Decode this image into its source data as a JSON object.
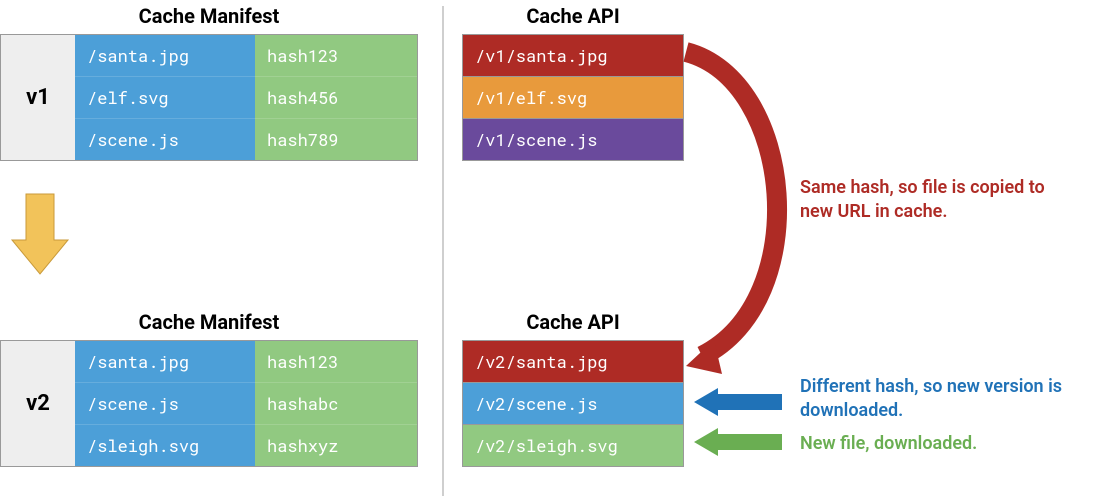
{
  "headings": {
    "manifest": "Cache Manifest",
    "api": "Cache API"
  },
  "manifest_v1": {
    "version": "v1",
    "rows": [
      {
        "file": "/santa.jpg",
        "hash": "hash123"
      },
      {
        "file": "/elf.svg",
        "hash": "hash456"
      },
      {
        "file": "/scene.js",
        "hash": "hash789"
      }
    ]
  },
  "manifest_v2": {
    "version": "v2",
    "rows": [
      {
        "file": "/santa.jpg",
        "hash": "hash123"
      },
      {
        "file": "/scene.js",
        "hash": "hashabc"
      },
      {
        "file": "/sleigh.svg",
        "hash": "hashxyz"
      }
    ]
  },
  "api_v1": {
    "rows": [
      {
        "prefix": "/v1",
        "file": "/santa.jpg",
        "color": "#ae2b25"
      },
      {
        "prefix": "/v1",
        "file": "/elf.svg",
        "color": "#e89a3c"
      },
      {
        "prefix": "/v1",
        "file": "/scene.js",
        "color": "#6a4a9c"
      }
    ]
  },
  "api_v2": {
    "rows": [
      {
        "prefix": "/v2",
        "file": "/santa.jpg",
        "color": "#ae2b25"
      },
      {
        "prefix": "/v2",
        "file": "/scene.js",
        "color": "#4c9fd8"
      },
      {
        "prefix": "/v2",
        "file": "/sleigh.svg",
        "color": "#91c981"
      }
    ]
  },
  "notes": {
    "same_hash": "Same hash, so file is copied to new URL in cache.",
    "diff_hash": "Different hash, so new version is downloaded.",
    "new_file": "New file, downloaded."
  },
  "colors": {
    "down_arrow": "#f2c35a",
    "curve_arrow": "#ae2b25",
    "diff_arrow": "#2072b7",
    "new_arrow": "#6aae52"
  }
}
